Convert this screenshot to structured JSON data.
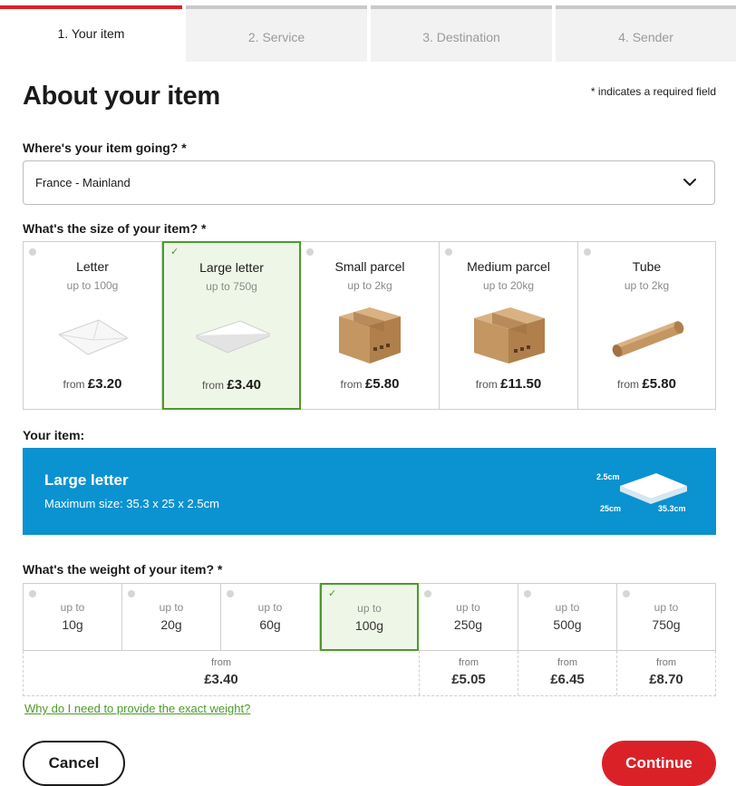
{
  "steps": [
    {
      "label": "1. Your item",
      "active": true
    },
    {
      "label": "2. Service",
      "active": false
    },
    {
      "label": "3. Destination",
      "active": false
    },
    {
      "label": "4. Sender",
      "active": false
    }
  ],
  "page": {
    "title": "About your item",
    "required_note": "* indicates a required field"
  },
  "destination": {
    "label": "Where's your item going? *",
    "value": "France - Mainland",
    "icon": "chevron-down-icon"
  },
  "size": {
    "label": "What's the size of your item? *",
    "options": [
      {
        "name": "Letter",
        "limit": "up to 100g",
        "from": "from",
        "price": "£3.20",
        "selected": false,
        "icon": "envelope-icon"
      },
      {
        "name": "Large letter",
        "limit": "up to 750g",
        "from": "from",
        "price": "£3.40",
        "selected": true,
        "icon": "large-letter-icon"
      },
      {
        "name": "Small parcel",
        "limit": "up to 2kg",
        "from": "from",
        "price": "£5.80",
        "selected": false,
        "icon": "small-box-icon"
      },
      {
        "name": "Medium parcel",
        "limit": "up to 20kg",
        "from": "from",
        "price": "£11.50",
        "selected": false,
        "icon": "medium-box-icon"
      },
      {
        "name": "Tube",
        "limit": "up to 2kg",
        "from": "from",
        "price": "£5.80",
        "selected": false,
        "icon": "tube-icon"
      }
    ]
  },
  "item": {
    "label": "Your item:",
    "title": "Large letter",
    "subtitle": "Maximum size: 35.3 x 25 x 2.5cm",
    "dims": {
      "height": "2.5cm",
      "width": "25cm",
      "length": "35.3cm"
    }
  },
  "weight": {
    "label": "What's the weight of your item? *",
    "upto": "up to",
    "options": [
      {
        "value": "10g",
        "selected": false
      },
      {
        "value": "20g",
        "selected": false
      },
      {
        "value": "60g",
        "selected": false
      },
      {
        "value": "100g",
        "selected": true
      },
      {
        "value": "250g",
        "selected": false
      },
      {
        "value": "500g",
        "selected": false
      },
      {
        "value": "750g",
        "selected": false
      }
    ],
    "prices": [
      {
        "from": "from",
        "price": "£3.40"
      },
      {
        "from": "from",
        "price": "£5.05"
      },
      {
        "from": "from",
        "price": "£6.45"
      },
      {
        "from": "from",
        "price": "£8.70"
      }
    ],
    "why_link": "Why do I need to provide the exact weight?"
  },
  "actions": {
    "cancel": "Cancel",
    "continue": "Continue"
  },
  "colors": {
    "brand_red": "#da2128",
    "selected_green": "#4d9a2a",
    "banner_blue": "#0b92d0"
  }
}
